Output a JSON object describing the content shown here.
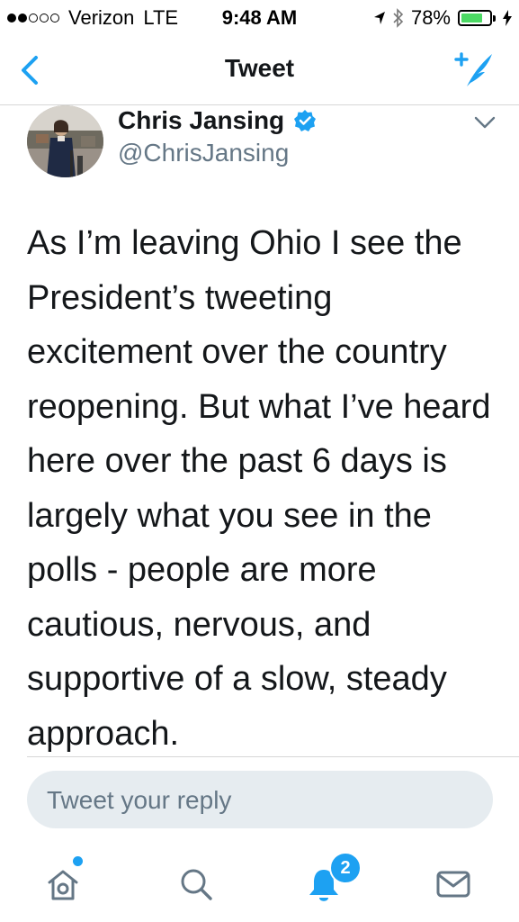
{
  "status_bar": {
    "carrier": "Verizon",
    "network": "LTE",
    "time": "9:48 AM",
    "battery_percent": "78%",
    "battery_level": 0.78,
    "signal_bars_filled": 2,
    "signal_bars_total": 5
  },
  "nav": {
    "title": "Tweet"
  },
  "tweet": {
    "author_name": "Chris Jansing",
    "handle": "@ChrisJansing",
    "text": "As I’m leaving Ohio I see the President’s tweeting excitement over the country reopening. But what I’ve heard here over the past 6 days is largely what you see in the polls - people are more cautious, nervous, and supportive of a slow, steady approach."
  },
  "reply": {
    "placeholder": "Tweet your reply"
  },
  "tabbar": {
    "notifications_badge": "2"
  },
  "colors": {
    "accent": "#1da1f2",
    "text": "#14171a",
    "secondary_text": "#657786",
    "reply_background": "#e6ecf0",
    "battery": "#4cd964"
  },
  "icons": [
    "back-chevron-icon",
    "compose-tweet-icon",
    "verified-badge-icon",
    "caret-down-icon",
    "home-icon",
    "search-icon",
    "notifications-bell-icon",
    "messages-envelope-icon",
    "location-arrow-icon",
    "bluetooth-icon",
    "charging-bolt-icon"
  ]
}
